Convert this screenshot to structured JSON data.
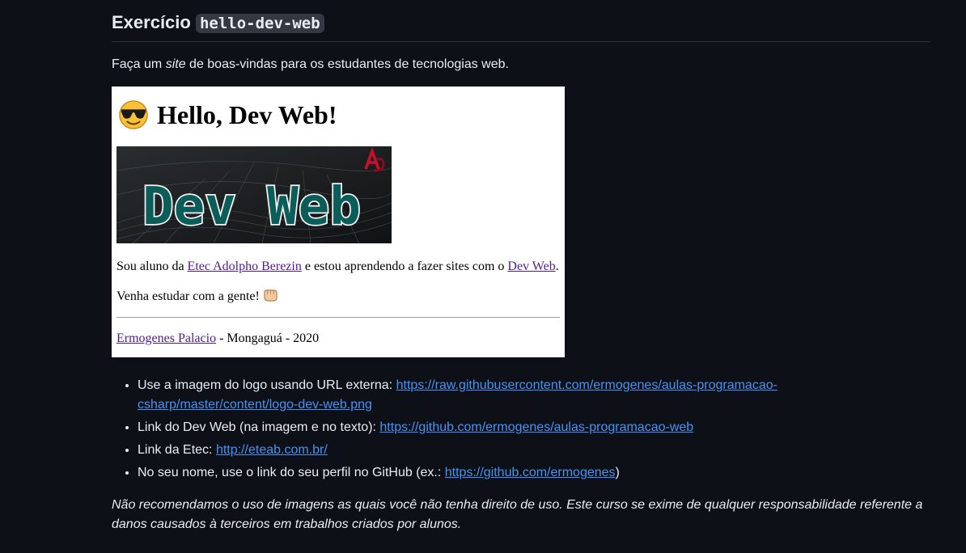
{
  "heading": {
    "prefix": "Exercício",
    "code": "hello-dev-web"
  },
  "intro": {
    "before": "Faça um ",
    "em": "site",
    "after": " de boas-vindas para os estudantes de tecnologias web."
  },
  "preview": {
    "title": "Hello, Dev Web!",
    "title_emoji": "smiling-face-with-sunglasses-icon",
    "logo_text": "Dev Web",
    "p1_before": "Sou aluno da ",
    "p1_link1": "Etec Adolpho Berezin",
    "p1_middle": " e estou aprendendo a fazer sites com o ",
    "p1_link2": "Dev Web",
    "p1_after": ".",
    "p2_text": "Venha estudar com a gente!",
    "p2_emoji": "fist-bump-icon",
    "footer_link": "Ermogenes Palacio",
    "footer_text": " - Mongaguá - 2020"
  },
  "list": [
    {
      "text": "Use a imagem do logo usando URL externa: ",
      "link": "https://raw.githubusercontent.com/ermogenes/aulas-programacao-csharp/master/content/logo-dev-web.png",
      "after": ""
    },
    {
      "text": "Link do Dev Web (na imagem e no texto): ",
      "link": "https://github.com/ermogenes/aulas-programacao-web",
      "after": ""
    },
    {
      "text": "Link da Etec: ",
      "link": "http://eteab.com.br/",
      "after": ""
    },
    {
      "text": "No seu nome, use o link do seu perfil no GitHub (ex.: ",
      "link": "https://github.com/ermogenes",
      "after": ")"
    }
  ],
  "note": "Não recomendamos o uso de imagens as quais você não tenha direito de uso. Este curso se exime de qualquer responsabilidade referente a danos causados à terceiros em trabalhos criados por alunos.",
  "colors": {
    "background": "#0d1117",
    "text": "#e6edf3",
    "link": "#4493f8",
    "visited_link": "#551a8b",
    "logo_teal": "#0b5d5a"
  }
}
